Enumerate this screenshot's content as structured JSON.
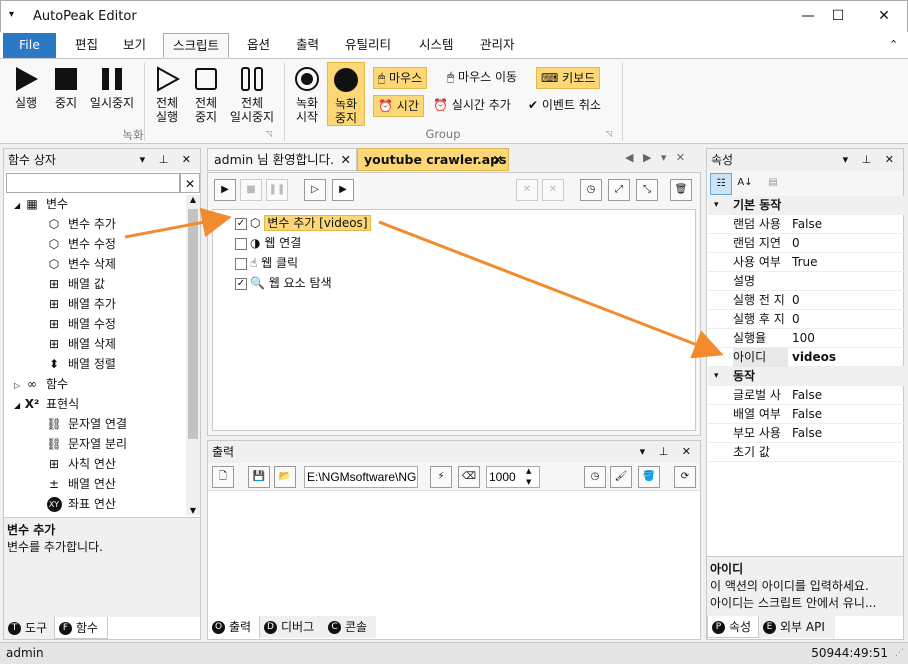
{
  "app": {
    "title": "AutoPeak Editor",
    "quick_access": "▾"
  },
  "window_controls": {
    "minimize": "—",
    "maximize": "☐",
    "close": "✕"
  },
  "menu": {
    "file": "File",
    "tabs": [
      "편집",
      "보기",
      "스크립트",
      "옵션",
      "출력",
      "유틸리티",
      "시스템",
      "관리자"
    ],
    "selected": "스크립트",
    "collapse": "⌃"
  },
  "ribbon": {
    "record_group": {
      "label": "녹화",
      "buttons": [
        {
          "label1": "실행",
          "label2": "",
          "icon": "play-icon"
        },
        {
          "label1": "중지",
          "label2": "",
          "icon": "stop-icon"
        },
        {
          "label1": "일시중지",
          "label2": "",
          "icon": "pause-icon"
        },
        {
          "label1": "전체",
          "label2": "실행",
          "icon": "play-outline-icon"
        },
        {
          "label1": "전체",
          "label2": "중지",
          "icon": "stop-outline-icon"
        },
        {
          "label1": "전체",
          "label2": "일시중지",
          "icon": "pause-outline-icon"
        }
      ]
    },
    "group_group": {
      "label": "Group",
      "buttons": [
        {
          "label1": "녹화",
          "label2": "시작",
          "icon": "record-start-icon"
        },
        {
          "label1": "녹화",
          "label2": "중지",
          "icon": "record-stop-icon"
        }
      ],
      "options": {
        "mouse": "마우스",
        "mouse_move": "마우스 이동",
        "keyboard": "키보드",
        "time": "시간",
        "realtime_add": "실시간 추가",
        "event_cancel": "이벤트 취소"
      }
    }
  },
  "function_box": {
    "title": "함수 상자",
    "search_value": "",
    "tree": [
      {
        "label": "변수",
        "level": 0,
        "icon": "variable-group-icon",
        "expander": "◢"
      },
      {
        "label": "변수 추가",
        "level": 1,
        "icon": "cube-add-icon"
      },
      {
        "label": "변수 수정",
        "level": 1,
        "icon": "cube-edit-icon"
      },
      {
        "label": "변수 삭제",
        "level": 1,
        "icon": "cube-delete-icon"
      },
      {
        "label": "배열 값",
        "level": 1,
        "icon": "array-value-icon"
      },
      {
        "label": "배열 추가",
        "level": 1,
        "icon": "array-add-icon"
      },
      {
        "label": "배열 수정",
        "level": 1,
        "icon": "array-edit-icon"
      },
      {
        "label": "배열 삭제",
        "level": 1,
        "icon": "array-delete-icon"
      },
      {
        "label": "배열 정렬",
        "level": 1,
        "icon": "array-sort-icon"
      },
      {
        "label": "함수",
        "level": 0,
        "icon": "function-icon",
        "expander": "▷"
      },
      {
        "label": "표현식",
        "level": 0,
        "icon": "expression-icon",
        "expander": "◢"
      },
      {
        "label": "문자열 연결",
        "level": 1,
        "icon": "link-icon"
      },
      {
        "label": "문자열 분리",
        "level": 1,
        "icon": "unlink-icon"
      },
      {
        "label": "사칙 연산",
        "level": 1,
        "icon": "arithmetic-icon"
      },
      {
        "label": "배열 연산",
        "level": 1,
        "icon": "plus-minus-icon"
      },
      {
        "label": "좌표 연산",
        "level": 1,
        "icon": "xy-icon"
      }
    ],
    "desc_title": "변수 추가",
    "desc_text": "변수를 추가합니다.",
    "tabs": [
      {
        "label": "도구",
        "badge": "T"
      },
      {
        "label": "함수",
        "badge": "F"
      }
    ]
  },
  "editor": {
    "tabs": [
      {
        "label": "admin 님 환영합니다.",
        "close": "✕"
      },
      {
        "label": "youtube crawler.aps",
        "close": "✕"
      }
    ],
    "nav": "◀ ▶ ▾ ✕",
    "actions": [
      {
        "label": "변수 추가 [videos]",
        "checked": true,
        "icon": "cube-add-icon"
      },
      {
        "label": "웹 연결",
        "checked": false,
        "icon": "web-connect-icon"
      },
      {
        "label": "웹 클릭",
        "checked": false,
        "icon": "web-click-icon"
      },
      {
        "label": "웹 요소 탐색",
        "checked": true,
        "icon": "web-search-icon"
      }
    ]
  },
  "output": {
    "title": "출력",
    "path": "E:\\NGMsoftware\\NG",
    "number": "1000",
    "tabs": [
      {
        "label": "출력",
        "badge": "O"
      },
      {
        "label": "디버그",
        "badge": "D"
      },
      {
        "label": "콘솔",
        "badge": "C"
      }
    ]
  },
  "properties": {
    "title": "속성",
    "categories": [
      {
        "name": "기본 동작",
        "rows": [
          {
            "key": "랜덤 사용",
            "value": "False"
          },
          {
            "key": "랜덤 지연",
            "value": "0"
          },
          {
            "key": "사용 여부",
            "value": "True"
          },
          {
            "key": "설명",
            "value": ""
          },
          {
            "key": "실행 전 지",
            "value": "0"
          },
          {
            "key": "실행 후 지",
            "value": "0"
          },
          {
            "key": "실행율",
            "value": "100"
          },
          {
            "key": "아이디",
            "value": "videos"
          }
        ]
      },
      {
        "name": "동작",
        "rows": [
          {
            "key": "글로벌 사",
            "value": "False"
          },
          {
            "key": "배열 여부",
            "value": "False"
          },
          {
            "key": "부모 사용",
            "value": "False"
          },
          {
            "key": "초기 값",
            "value": ""
          }
        ]
      }
    ],
    "desc_title": "아이디",
    "desc_line1": "이 액션의 아이디를 입력하세요.",
    "desc_line2": "아이디는 스크립트 안에서 유니...",
    "tabs": [
      {
        "label": "속성",
        "badge": "P"
      },
      {
        "label": "외부 API",
        "badge": "E"
      }
    ]
  },
  "status": {
    "user": "admin",
    "timer": "50944:49:51"
  },
  "colors": {
    "accent": "#2b78c5",
    "highlight": "#fbd776",
    "arrow": "#f28a2e"
  }
}
